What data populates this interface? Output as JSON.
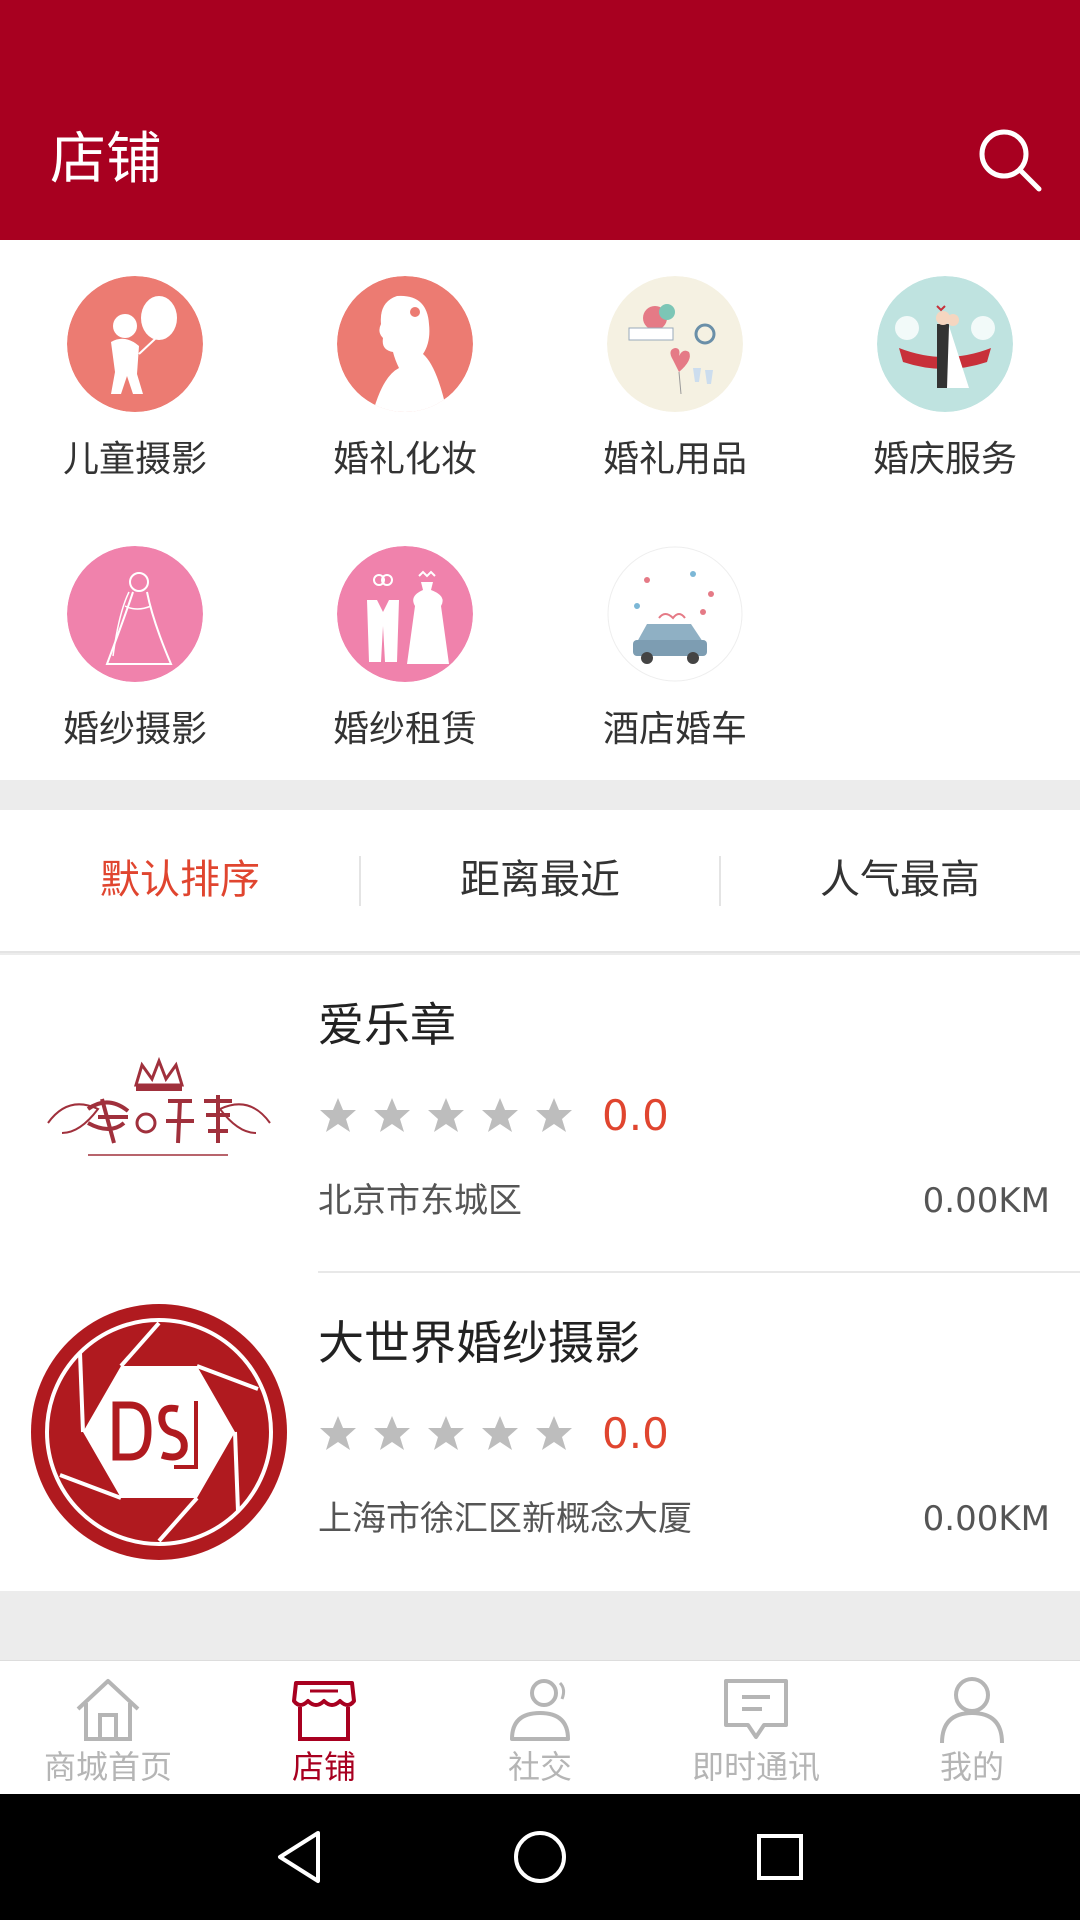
{
  "header": {
    "title": "店铺",
    "search_icon": "search-icon",
    "background": "#a80020"
  },
  "categories": [
    {
      "label": "儿童摄影",
      "icon": "child-balloon-icon",
      "color": "#ec7b72"
    },
    {
      "label": "婚礼化妆",
      "icon": "bride-profile-icon",
      "color": "#ec7b72"
    },
    {
      "label": "婚礼用品",
      "icon": "wedding-supplies-icon",
      "color": "#f5f1e2"
    },
    {
      "label": "婚庆服务",
      "icon": "wedding-couple-icon",
      "color": "#bfe3e0"
    },
    {
      "label": "婚纱摄影",
      "icon": "bride-sketch-icon",
      "color": "#f082ac"
    },
    {
      "label": "婚纱租赁",
      "icon": "suit-and-gown-icon",
      "color": "#f082ac"
    },
    {
      "label": "酒店婚车",
      "icon": "wedding-car-icon",
      "color": "#ffffff"
    }
  ],
  "sort": {
    "options": [
      "默认排序",
      "距离最近",
      "人气最高"
    ],
    "active_index": 0,
    "active_color": "#e0452f"
  },
  "shops": [
    {
      "name": "爱乐章",
      "rating": "0.0",
      "stars": 0,
      "address": "北京市东城区",
      "distance": "0.00KM",
      "logo": "ailezhang-logo"
    },
    {
      "name": "大世界婚纱摄影",
      "rating": "0.0",
      "stars": 0,
      "address": "上海市徐汇区新概念大厦",
      "distance": "0.00KM",
      "logo": "ds-logo"
    }
  ],
  "tabbar": {
    "items": [
      {
        "label": "商城首页",
        "icon": "home-icon"
      },
      {
        "label": "店铺",
        "icon": "store-icon"
      },
      {
        "label": "社交",
        "icon": "social-icon"
      },
      {
        "label": "即时通讯",
        "icon": "chat-icon"
      },
      {
        "label": "我的",
        "icon": "profile-icon"
      }
    ],
    "active_index": 1,
    "active_color": "#a80020",
    "inactive_color": "#b5b5b5"
  },
  "system_nav": {
    "icons": [
      "back-icon",
      "home-circle-icon",
      "recents-icon"
    ]
  }
}
